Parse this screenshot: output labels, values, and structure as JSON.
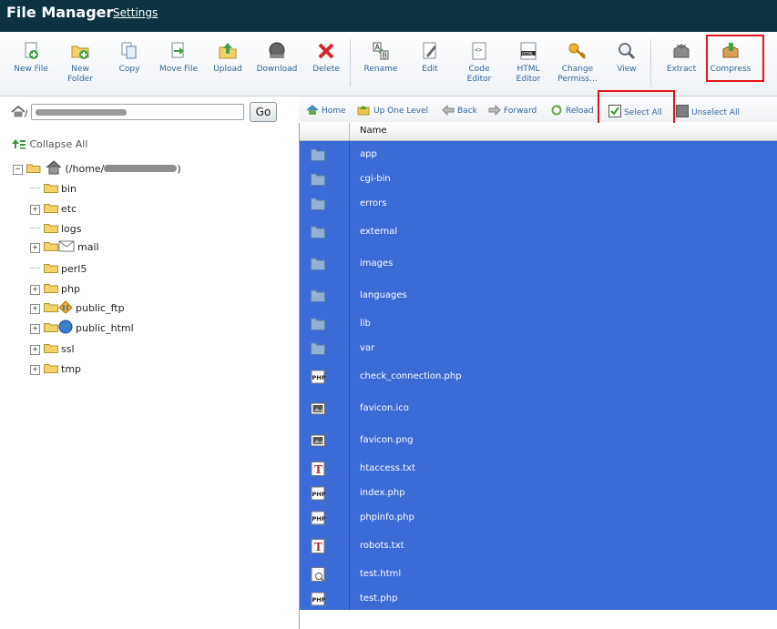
{
  "header": {
    "title": "File Manager",
    "settings": "Settings"
  },
  "toolbar": [
    {
      "label": "New File",
      "icon": "new-file-icon"
    },
    {
      "label": "New\nFolder",
      "icon": "new-folder-icon"
    },
    {
      "label": "Copy",
      "icon": "copy-icon"
    },
    {
      "label": "Move File",
      "icon": "move-file-icon"
    },
    {
      "label": "Upload",
      "icon": "upload-icon"
    },
    {
      "label": "Download",
      "icon": "download-icon"
    },
    {
      "label": "Delete",
      "icon": "delete-icon"
    },
    {
      "label": "Rename",
      "icon": "rename-icon"
    },
    {
      "label": "Edit",
      "icon": "edit-icon"
    },
    {
      "label": "Code\nEditor",
      "icon": "code-editor-icon"
    },
    {
      "label": "HTML\nEditor",
      "icon": "html-editor-icon"
    },
    {
      "label": "Change\nPermiss...",
      "icon": "change-permissions-icon"
    },
    {
      "label": "View",
      "icon": "view-icon"
    },
    {
      "label": "Extract",
      "icon": "extract-icon"
    },
    {
      "label": "Compress",
      "icon": "compress-icon"
    }
  ],
  "pathbar": {
    "go": "Go"
  },
  "nav": {
    "home": "Home",
    "up": "Up One Level",
    "back": "Back",
    "forward": "Forward",
    "reload": "Reload",
    "select_all": "Select All",
    "unselect_all": "Unselect All"
  },
  "tree": {
    "collapse_all": "Collapse All",
    "root": "(/home/",
    "root_end": ")",
    "items": [
      {
        "name": "bin",
        "expandable": false
      },
      {
        "name": "etc",
        "expandable": true
      },
      {
        "name": "logs",
        "expandable": false
      },
      {
        "name": "mail",
        "expandable": true
      },
      {
        "name": "perl5",
        "expandable": false
      },
      {
        "name": "php",
        "expandable": true
      },
      {
        "name": "public_ftp",
        "expandable": true
      },
      {
        "name": "public_html",
        "expandable": true
      },
      {
        "name": "ssl",
        "expandable": true
      },
      {
        "name": "tmp",
        "expandable": true
      }
    ]
  },
  "list": {
    "header_name": "Name",
    "files": [
      {
        "name": "app",
        "type": "folder"
      },
      {
        "name": "cgi-bin",
        "type": "folder"
      },
      {
        "name": "errors",
        "type": "folder"
      },
      {
        "name": "external",
        "type": "folder"
      },
      {
        "name": "images",
        "type": "folder"
      },
      {
        "name": "languages",
        "type": "folder"
      },
      {
        "name": "lib",
        "type": "folder"
      },
      {
        "name": "var",
        "type": "folder"
      },
      {
        "name": "check_connection.php",
        "type": "php"
      },
      {
        "name": "favicon.ico",
        "type": "image"
      },
      {
        "name": "favicon.png",
        "type": "image"
      },
      {
        "name": "htaccess.txt",
        "type": "text"
      },
      {
        "name": "index.php",
        "type": "php"
      },
      {
        "name": "phpinfo.php",
        "type": "php"
      },
      {
        "name": "robots.txt",
        "type": "text"
      },
      {
        "name": "test.html",
        "type": "html"
      },
      {
        "name": "test.php",
        "type": "php"
      }
    ]
  },
  "colors": {
    "topbar": "#0b3340",
    "selection": "#3b6bd6",
    "highlight": "#e4141b",
    "link": "#336699"
  }
}
